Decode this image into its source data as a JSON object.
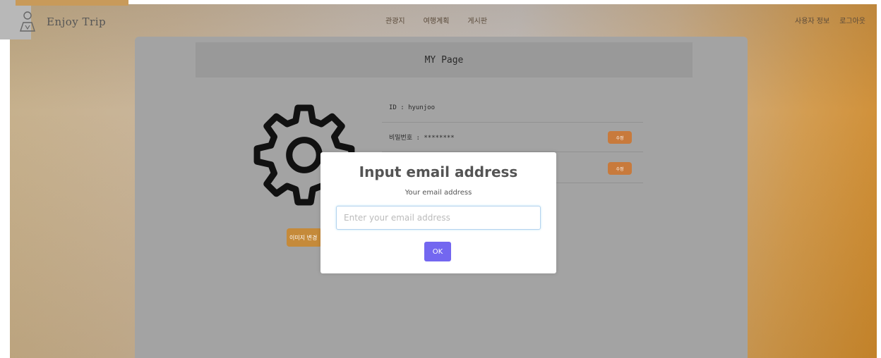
{
  "brand": {
    "name": "Enjoy Trip",
    "icon": "traveler-logo-icon"
  },
  "nav": {
    "center": [
      "관광지",
      "여행계획",
      "게시판"
    ],
    "right": [
      "사용자 정보",
      "로그아웃"
    ]
  },
  "page": {
    "title": "MY Page",
    "avatar_icon": "gear-icon",
    "edit_label": "이미지 변경",
    "rows": [
      {
        "label": "ID : hyunjoo",
        "button": ""
      },
      {
        "label": "비밀번호 : ********",
        "button": "수정"
      },
      {
        "label": "",
        "button": "수정"
      }
    ]
  },
  "modal": {
    "title": "Input email address",
    "subtitle": "Your email address",
    "placeholder": "Enter your email address",
    "ok_label": "OK"
  },
  "colors": {
    "accent": "#7367f0",
    "orange": "#c87a3c"
  }
}
